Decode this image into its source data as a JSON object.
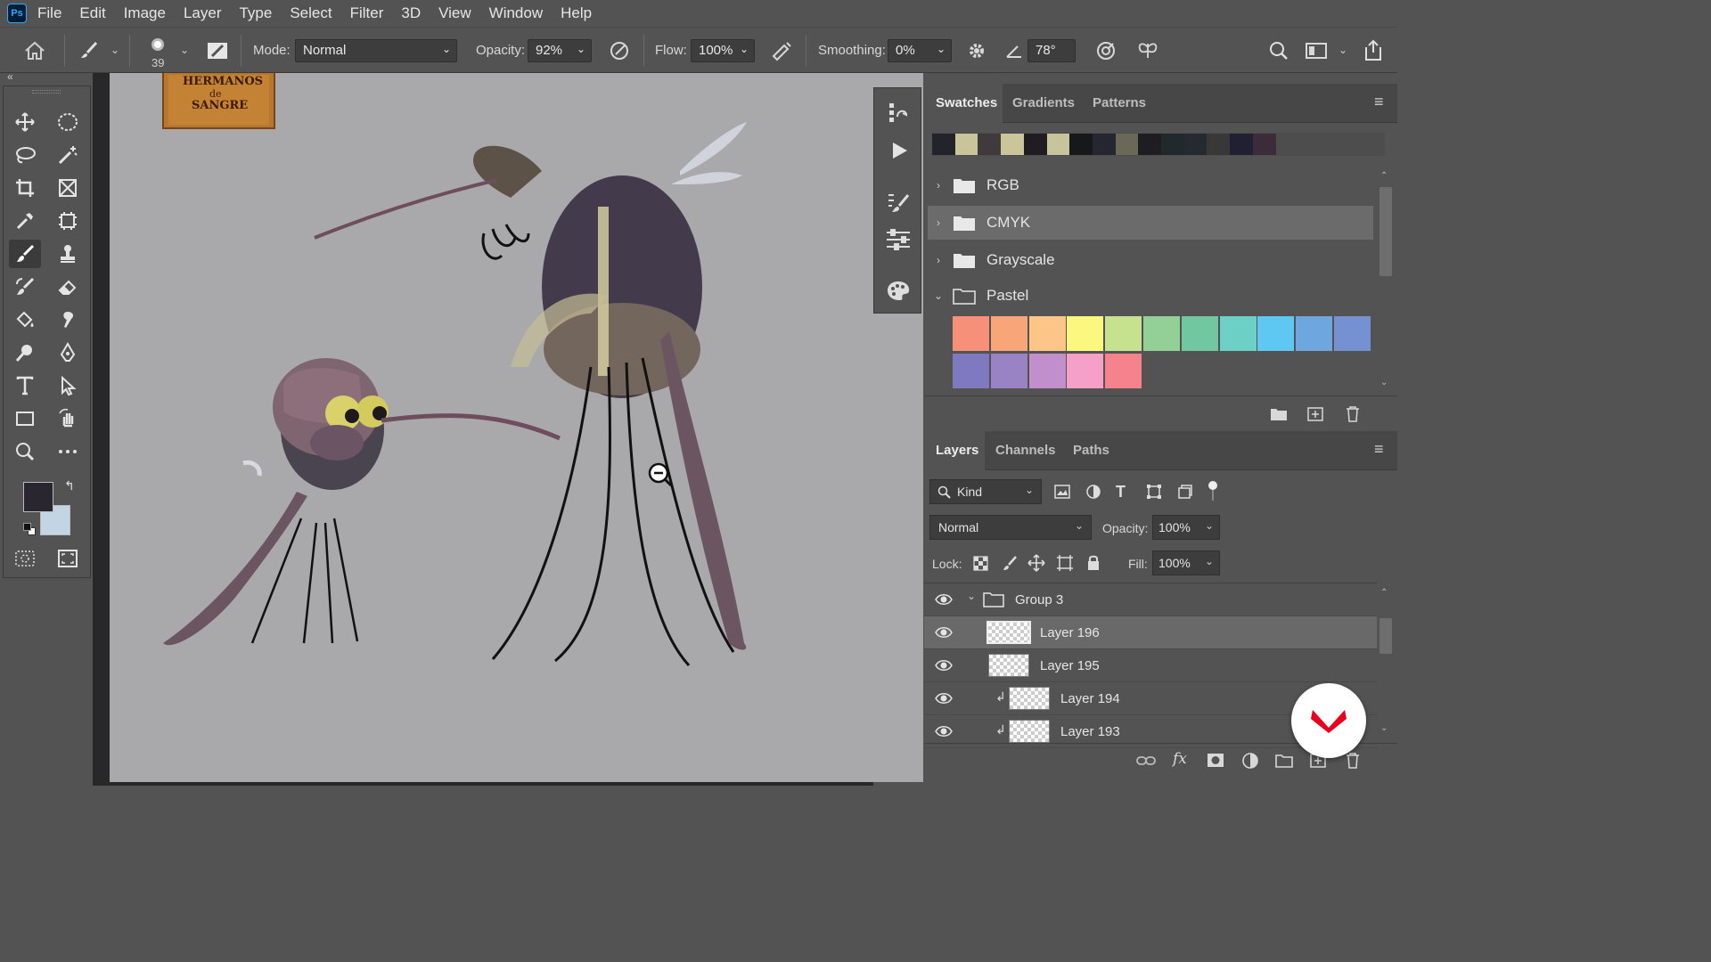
{
  "app": {
    "logo": "Ps",
    "accent": "#31a8ff"
  },
  "menu": [
    "File",
    "Edit",
    "Image",
    "Layer",
    "Type",
    "Select",
    "Filter",
    "3D",
    "View",
    "Window",
    "Help"
  ],
  "options": {
    "brush_size": "39",
    "mode_label": "Mode:",
    "mode_value": "Normal",
    "opacity_label": "Opacity:",
    "opacity_value": "92%",
    "flow_label": "Flow:",
    "flow_value": "100%",
    "smoothing_label": "Smoothing:",
    "smoothing_value": "0%",
    "angle_value": "78°"
  },
  "colors": {
    "foreground": "#2a2630",
    "background": "#c3d4e2"
  },
  "canvas": {
    "sign_text_1": "HERMANOS",
    "sign_text_2": "de",
    "sign_text_3": "SANGRE"
  },
  "swatches_panel": {
    "tabs": [
      "Swatches",
      "Gradients",
      "Patterns"
    ],
    "recent": [
      "#23232b",
      "#c9c49a",
      "#403a3d",
      "#cbc69a",
      "#1f1d22",
      "#c7c39a",
      "#161819",
      "#262633",
      "#6a6857",
      "#1e1e22",
      "#20292c",
      "#252a31",
      "#393838",
      "#212033",
      "#3c2c3a"
    ],
    "groups": [
      {
        "name": "RGB",
        "expanded": false
      },
      {
        "name": "CMYK",
        "expanded": false
      },
      {
        "name": "Grayscale",
        "expanded": false
      },
      {
        "name": "Pastel",
        "expanded": true
      }
    ],
    "pastel": [
      "#f69078",
      "#f8a57a",
      "#fdc688",
      "#fcf77e",
      "#c6e28e",
      "#92d097",
      "#71c8a0",
      "#6cd0c6",
      "#5ec8f2",
      "#6ea7e0",
      "#7591d1",
      "#7f79c0",
      "#9a83c4",
      "#c190cc",
      "#f5a0c8",
      "#f5828c"
    ]
  },
  "layers_panel": {
    "tabs": [
      "Layers",
      "Channels",
      "Paths"
    ],
    "filter_label": "Kind",
    "blend_mode": "Normal",
    "opacity_label": "Opacity:",
    "opacity_value": "100%",
    "lock_label": "Lock:",
    "fill_label": "Fill:",
    "fill_value": "100%",
    "layers": [
      {
        "name": "Group 3",
        "type": "group"
      },
      {
        "name": "Layer 196",
        "type": "layer",
        "selected": true
      },
      {
        "name": "Layer 195",
        "type": "layer"
      },
      {
        "name": "Layer 194",
        "type": "clipped"
      },
      {
        "name": "Layer 193",
        "type": "clipped"
      }
    ]
  }
}
